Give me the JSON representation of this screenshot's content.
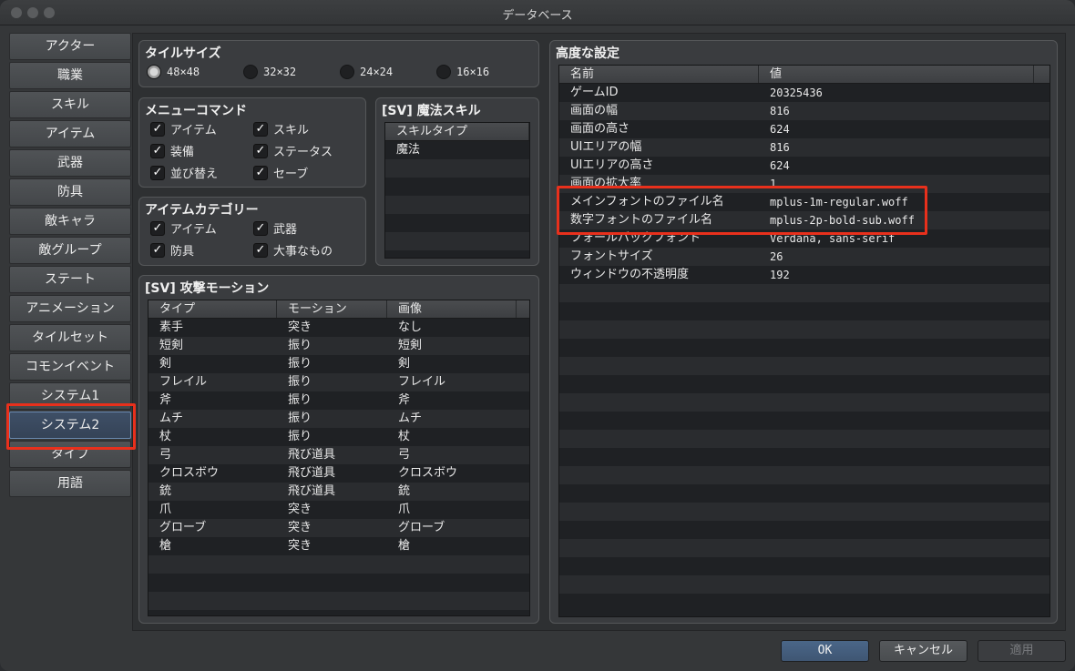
{
  "window": {
    "title": "データベース"
  },
  "sidebar": {
    "items": [
      "アクター",
      "職業",
      "スキル",
      "アイテム",
      "武器",
      "防具",
      "敵キャラ",
      "敵グループ",
      "ステート",
      "アニメーション",
      "タイルセット",
      "コモンイベント",
      "システム1",
      "システム2",
      "タイプ",
      "用語"
    ],
    "active": "システム2"
  },
  "tile_size": {
    "title": "タイルサイズ",
    "options": [
      "48×48",
      "32×32",
      "24×24",
      "16×16"
    ],
    "selected": "48×48"
  },
  "menu_commands": {
    "title": "メニューコマンド",
    "items": [
      {
        "label": "アイテム",
        "checked": true
      },
      {
        "label": "スキル",
        "checked": true
      },
      {
        "label": "装備",
        "checked": true
      },
      {
        "label": "ステータス",
        "checked": true
      },
      {
        "label": "並び替え",
        "checked": true
      },
      {
        "label": "セーブ",
        "checked": true
      }
    ]
  },
  "item_categories": {
    "title": "アイテムカテゴリー",
    "items": [
      {
        "label": "アイテム",
        "checked": true
      },
      {
        "label": "武器",
        "checked": true
      },
      {
        "label": "防具",
        "checked": true
      },
      {
        "label": "大事なもの",
        "checked": true
      }
    ]
  },
  "sv_magic": {
    "title": "[SV] 魔法スキル",
    "header": "スキルタイプ",
    "rows": [
      "魔法"
    ]
  },
  "sv_motion": {
    "title": "[SV] 攻撃モーション",
    "headers": [
      "タイプ",
      "モーション",
      "画像"
    ],
    "rows": [
      [
        "素手",
        "突き",
        "なし"
      ],
      [
        "短剣",
        "振り",
        "短剣"
      ],
      [
        "剣",
        "振り",
        "剣"
      ],
      [
        "フレイル",
        "振り",
        "フレイル"
      ],
      [
        "斧",
        "振り",
        "斧"
      ],
      [
        "ムチ",
        "振り",
        "ムチ"
      ],
      [
        "杖",
        "振り",
        "杖"
      ],
      [
        "弓",
        "飛び道具",
        "弓"
      ],
      [
        "クロスボウ",
        "飛び道具",
        "クロスボウ"
      ],
      [
        "銃",
        "飛び道具",
        "銃"
      ],
      [
        "爪",
        "突き",
        "爪"
      ],
      [
        "グローブ",
        "突き",
        "グローブ"
      ],
      [
        "槍",
        "突き",
        "槍"
      ]
    ]
  },
  "advanced": {
    "title": "高度な設定",
    "headers": [
      "名前",
      "値"
    ],
    "rows": [
      [
        "ゲームID",
        "20325436"
      ],
      [
        "画面の幅",
        "816"
      ],
      [
        "画面の高さ",
        "624"
      ],
      [
        "UIエリアの幅",
        "816"
      ],
      [
        "UIエリアの高さ",
        "624"
      ],
      [
        "画面の拡大率",
        "1"
      ],
      [
        "メインフォントのファイル名",
        "mplus-1m-regular.woff"
      ],
      [
        "数字フォントのファイル名",
        "mplus-2p-bold-sub.woff"
      ],
      [
        "フォールバックフォント",
        "Verdana, sans-serif"
      ],
      [
        "フォントサイズ",
        "26"
      ],
      [
        "ウィンドウの不透明度",
        "192"
      ]
    ]
  },
  "buttons": {
    "ok": "OK",
    "cancel": "キャンセル",
    "apply": "適用"
  },
  "colors": {
    "highlight": "#e8301c",
    "accent": "#3f5673"
  }
}
